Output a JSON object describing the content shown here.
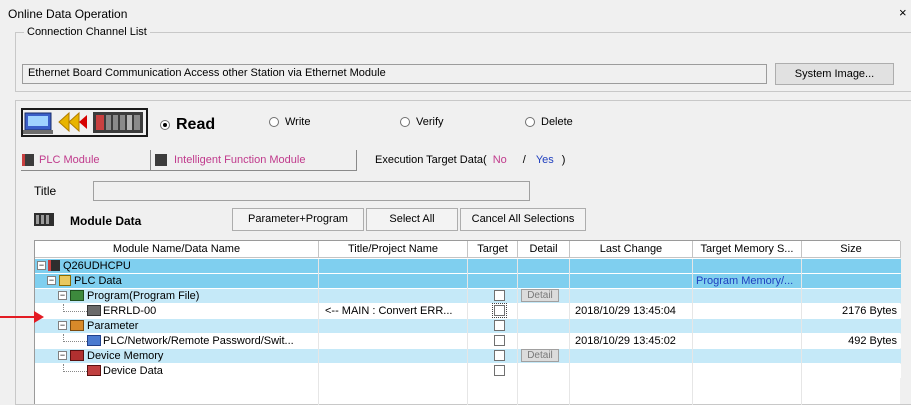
{
  "window": {
    "title": "Online Data Operation",
    "close_glyph": "×"
  },
  "connection": {
    "group_label": "Connection Channel List",
    "value": "Ethernet Board Communication  Access other Station via Ethernet Module",
    "system_image_button": "System Image..."
  },
  "operations": [
    {
      "label": "Read",
      "selected": true
    },
    {
      "label": "Write",
      "selected": false
    },
    {
      "label": "Verify",
      "selected": false
    },
    {
      "label": "Delete",
      "selected": false
    }
  ],
  "tabs": {
    "plc_module": "PLC Module",
    "intelligent": "Intelligent Function Module",
    "exec_target": "Execution Target Data(",
    "no": "No",
    "slash": "/",
    "yes": "Yes",
    "close_paren": ")"
  },
  "title_field": {
    "label": "Title",
    "value": ""
  },
  "module_data": {
    "label": "Module Data",
    "param_prog_button": "Parameter+Program",
    "select_all_button": "Select All",
    "cancel_all_button": "Cancel All Selections"
  },
  "columns": [
    "Module Name/Data Name",
    "Title/Project Name",
    "Target",
    "Detail",
    "Last Change",
    "Target Memory S...",
    "Size"
  ],
  "rows": [
    {
      "name": "Q26UDHCPU",
      "title": "",
      "target": false,
      "show_check": false,
      "detail": "",
      "last_change": "",
      "memory": "",
      "size": ""
    },
    {
      "name": "PLC Data",
      "title": "",
      "target": false,
      "show_check": false,
      "detail": "",
      "last_change": "",
      "memory": "Program Memory/...",
      "size": ""
    },
    {
      "name": "Program(Program File)",
      "title": "",
      "target": false,
      "show_check": true,
      "detail": "Detail",
      "last_change": "",
      "memory": "",
      "size": ""
    },
    {
      "name": "ERRLD-00",
      "title": "<-- MAIN : Convert ERR...",
      "target": false,
      "show_check": true,
      "detail": "",
      "last_change": "2018/10/29 13:45:04",
      "memory": "",
      "size": "2176 Bytes"
    },
    {
      "name": "Parameter",
      "title": "",
      "target": false,
      "show_check": true,
      "detail": "",
      "last_change": "",
      "memory": "",
      "size": ""
    },
    {
      "name": "PLC/Network/Remote Password/Swit...",
      "title": "",
      "target": false,
      "show_check": true,
      "detail": "",
      "last_change": "2018/10/29 13:45:02",
      "memory": "",
      "size": "492 Bytes"
    },
    {
      "name": "Device Memory",
      "title": "",
      "target": false,
      "show_check": true,
      "detail": "Detail",
      "last_change": "",
      "memory": "",
      "size": ""
    },
    {
      "name": "Device Data",
      "title": "",
      "target": false,
      "show_check": true,
      "detail": "",
      "last_change": "",
      "memory": "",
      "size": ""
    }
  ],
  "colors": {
    "row_blue": "#7fcfef",
    "row_light_blue": "#c5e9f8",
    "arrow_red": "#e31b23",
    "tab_pink": "#c03a8c",
    "tab_blue": "#1f3fbf"
  }
}
